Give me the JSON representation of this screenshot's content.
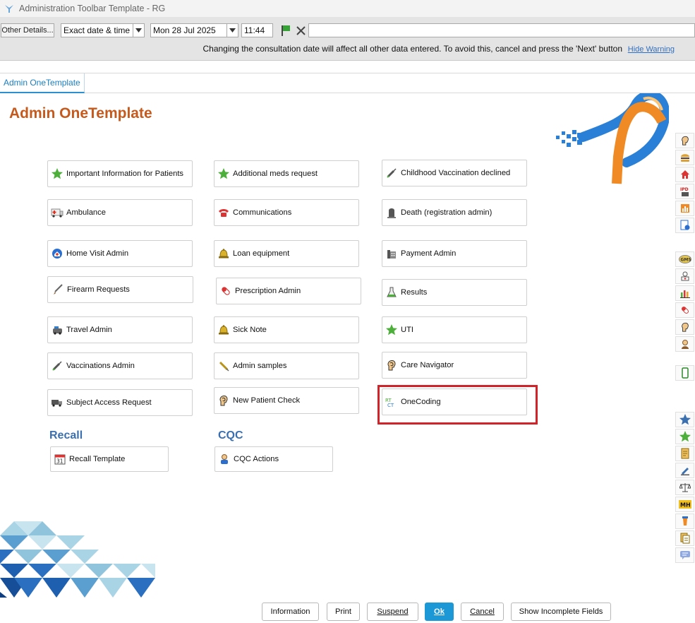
{
  "window": {
    "title": "Administration Toolbar Template - RG"
  },
  "toolbar": {
    "other_details_label": "Other Details...",
    "date_mode": "Exact date & time",
    "date": "Mon 28 Jul 2025",
    "time": "11:44",
    "free_text_value": "",
    "warning_text": "Changing the consultation date will affect all other data entered. To avoid this, cancel and press the 'Next' button",
    "hide_warning_label": "Hide Warning"
  },
  "tabs": [
    {
      "label": "Admin OneTemplate"
    }
  ],
  "page": {
    "title": "Admin OneTemplate"
  },
  "tiles": [
    {
      "label": "Important Information for Patients",
      "icon": "green-star-icon"
    },
    {
      "label": "Additional meds request",
      "icon": "green-star-icon"
    },
    {
      "label": "Childhood Vaccination declined",
      "icon": "syringe-icon"
    },
    {
      "label": "Ambulance",
      "icon": "ambulance-icon"
    },
    {
      "label": "Communications",
      "icon": "telephone-icon"
    },
    {
      "label": "Death (registration admin)",
      "icon": "gravestone-icon"
    },
    {
      "label": "Home Visit Admin",
      "icon": "home-visit-icon"
    },
    {
      "label": "Loan equipment",
      "icon": "bell-icon"
    },
    {
      "label": "Payment Admin",
      "icon": "payment-phone-icon"
    },
    {
      "label": "Firearm Requests",
      "icon": "rifle-icon"
    },
    {
      "label": "Prescription Admin",
      "icon": "pill-icon"
    },
    {
      "label": "Results",
      "icon": "flask-icon"
    },
    {
      "label": "Travel Admin",
      "icon": "travel-icon"
    },
    {
      "label": "Sick Note",
      "icon": "bell-icon"
    },
    {
      "label": "UTI",
      "icon": "green-star-icon"
    },
    {
      "label": "Vaccinations Admin",
      "icon": "syringe-icon"
    },
    {
      "label": "Admin samples",
      "icon": "swab-icon"
    },
    {
      "label": "Care Navigator",
      "icon": "head-icon"
    },
    {
      "label": "Subject Access Request",
      "icon": "truck-icon"
    },
    {
      "label": "New Patient Check",
      "icon": "head-icon"
    },
    {
      "label": "OneCoding",
      "icon": "onecoding-icon"
    }
  ],
  "sections": {
    "recall": {
      "title": "Recall",
      "tile_label": "Recall Template",
      "icon": "calendar-icon"
    },
    "cqc": {
      "title": "CQC",
      "tile_label": "CQC Actions",
      "icon": "person-icon"
    }
  },
  "sidebar_badges": {
    "gms": "GMS",
    "mh": "MH",
    "ipd": "IPD"
  },
  "footer": {
    "information": "Information",
    "print": "Print",
    "suspend": "Suspend",
    "ok": "Ok",
    "cancel": "Cancel",
    "show_incomplete": "Show Incomplete Fields"
  },
  "colors": {
    "accent": "#1c98d6",
    "title_orange": "#c55a1c",
    "section_blue": "#3a6fb0",
    "highlight_red": "#d0232a",
    "star_green": "#4caf3a"
  }
}
